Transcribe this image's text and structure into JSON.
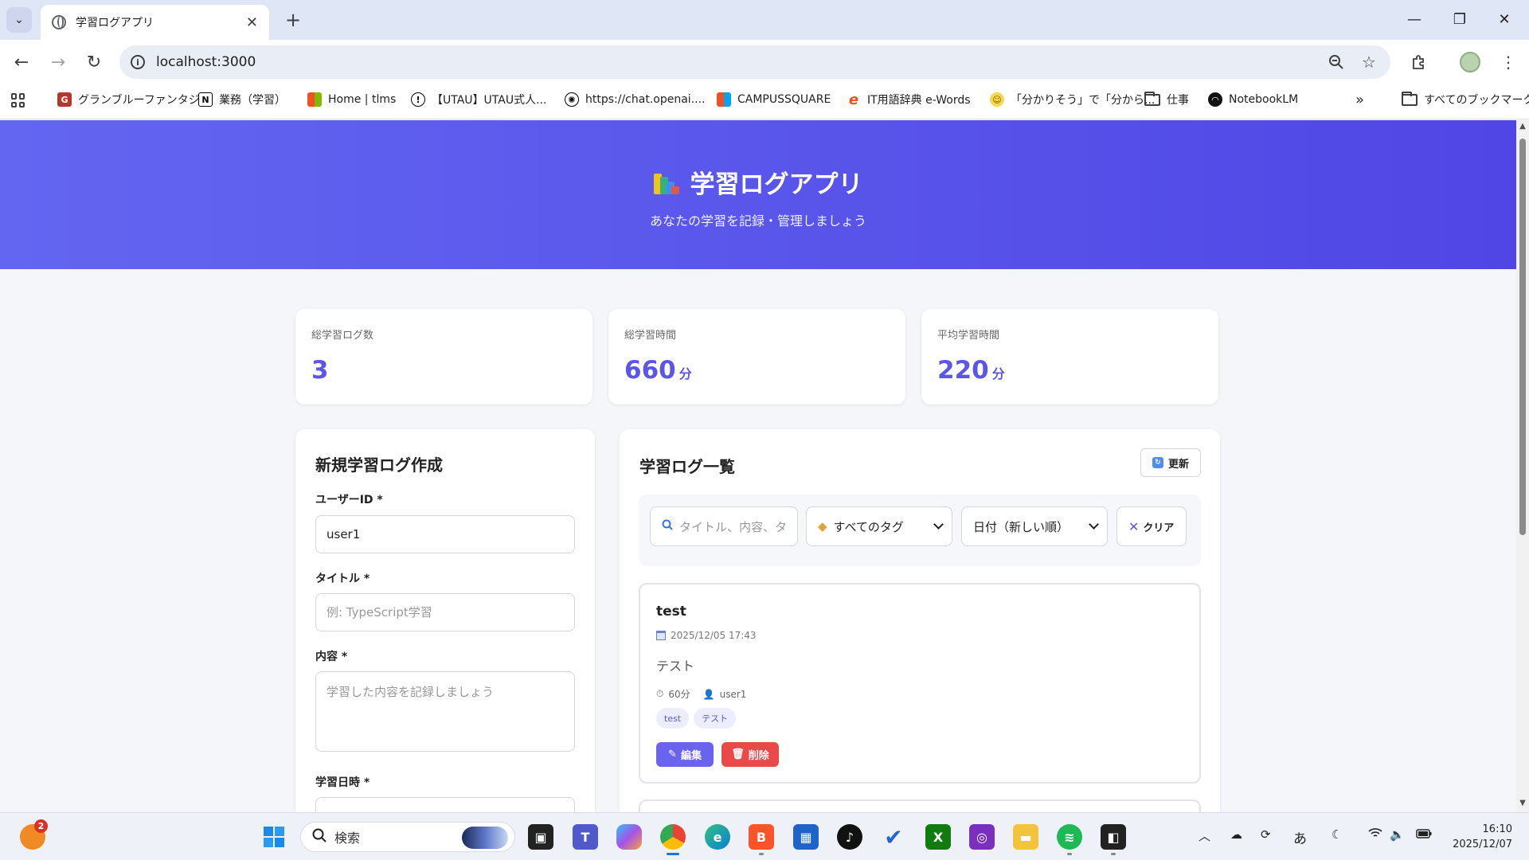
{
  "browser": {
    "tab_title": "学習ログアプリ",
    "tab_close": "✕",
    "new_tab": "+",
    "url": "localhost:3000",
    "window_minimize": "—",
    "window_restore": "❐",
    "window_close": "✕"
  },
  "bookmarks": {
    "items": [
      "グランブルーファンタジー",
      "業務（学習）",
      "Home | tlms",
      "【UTAU】UTAU式人...",
      "https://chat.openai....",
      "CAMPUSSQUARE",
      "IT用語辞典 e-Words",
      "「分かりそう」で「分から...",
      "仕事",
      "NotebookLM"
    ],
    "more": "»",
    "all_bookmarks": "すべてのブックマーク"
  },
  "hero": {
    "title": "学習ログアプリ",
    "subtitle": "あなたの学習を記録・管理しましょう"
  },
  "stats": [
    {
      "label": "総学習ログ数",
      "value": "3",
      "unit": ""
    },
    {
      "label": "総学習時間",
      "value": "660",
      "unit": "分"
    },
    {
      "label": "平均学習時間",
      "value": "220",
      "unit": "分"
    }
  ],
  "form": {
    "title": "新規学習ログ作成",
    "user_id_label": "ユーザーID *",
    "user_id_value": "user1",
    "title_label": "タイトル *",
    "title_placeholder": "例: TypeScript学習",
    "content_label": "内容 *",
    "content_placeholder": "学習した内容を記録しましょう",
    "date_label": "学習日時 *"
  },
  "list": {
    "title": "学習ログ一覧",
    "refresh_label": "更新",
    "search_placeholder": "タイトル、内容、タ",
    "tag_filter": "すべてのタグ",
    "sort": "日付（新しい順）",
    "clear_label": "クリア",
    "logs": [
      {
        "title": "test",
        "date": "2025/12/05 17:43",
        "content": "テスト",
        "duration": "60分",
        "user": "user1",
        "tags": [
          "test",
          "テスト"
        ],
        "edit_label": "編集",
        "delete_label": "削除"
      }
    ]
  },
  "taskbar": {
    "search_placeholder": "検索",
    "notification_badge": "2",
    "ime": "あ",
    "time": "16:10",
    "date": "2025/12/07"
  },
  "colors": {
    "accent": "#5b55e8",
    "hero_start": "#6366f1",
    "hero_end": "#5046e5",
    "danger": "#ea4949"
  }
}
